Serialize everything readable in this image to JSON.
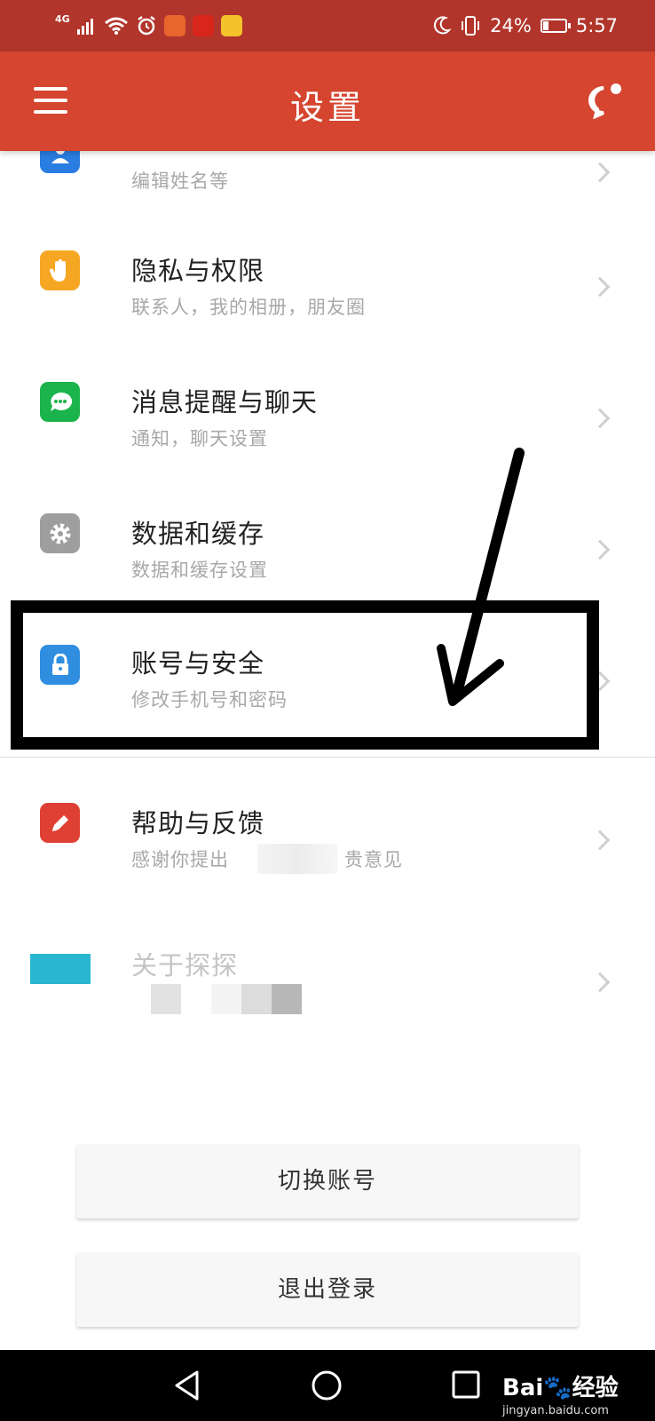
{
  "status_bar": {
    "network": "4G",
    "battery_percent": "24%",
    "battery_level": 0.24,
    "time": "5:57",
    "app_icon_colors": [
      "#e8652e",
      "#d9261c",
      "#f3c32c"
    ]
  },
  "app_bar": {
    "title": "设置",
    "color": "#d5452f"
  },
  "settings": {
    "items": [
      {
        "title": "",
        "subtitle": "编辑姓名等",
        "icon": "profile-icon",
        "icon_color": "#2a7de1"
      },
      {
        "title": "隐私与权限",
        "subtitle": "联系人，我的相册，朋友圈",
        "icon": "hand-icon",
        "icon_color": "#f5a623"
      },
      {
        "title": "消息提醒与聊天",
        "subtitle": "通知，聊天设置",
        "icon": "chat-bubble-icon",
        "icon_color": "#1bb34b"
      },
      {
        "title": "数据和缓存",
        "subtitle": "数据和缓存设置",
        "icon": "gear-icon",
        "icon_color": "#9e9e9e"
      },
      {
        "title": "账号与安全",
        "subtitle": "修改手机号和密码",
        "icon": "lock-icon",
        "icon_color": "#2f8ee0"
      },
      {
        "title": "帮助与反馈",
        "subtitle": "感谢你提出",
        "subtitle_end": "贵意见",
        "icon": "pencil-icon",
        "icon_color": "#de4134"
      },
      {
        "title": "关于探探",
        "subtitle": "",
        "icon": "info-icon",
        "icon_color": "#29b6cf"
      }
    ]
  },
  "buttons": {
    "switch_account": "切换账号",
    "logout": "退出登录"
  },
  "watermark": {
    "brand": "Bai",
    "suffix": "经验",
    "url": "jingyan.baidu.com"
  }
}
